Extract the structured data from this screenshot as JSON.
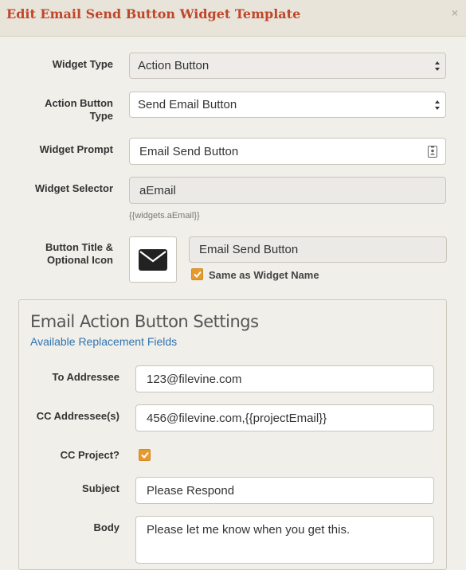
{
  "dialog": {
    "title": "Edit Email Send Button Widget Template",
    "close_label": "×"
  },
  "form": {
    "widget_type": {
      "label": "Widget Type",
      "value": "Action Button"
    },
    "action_button_type": {
      "label_line1": "Action Button",
      "label_line2": "Type",
      "value": "Send Email Button"
    },
    "widget_prompt": {
      "label": "Widget Prompt",
      "value": "Email Send Button"
    },
    "widget_selector": {
      "label": "Widget Selector",
      "value": "aEmail",
      "hint": "{{widgets.aEmail}}"
    },
    "button_title": {
      "label_line1": "Button Title &",
      "label_line2": "Optional Icon",
      "icon": "envelope-icon",
      "value": "Email Send Button",
      "same_as_name_label": "Same as Widget Name",
      "same_as_name_checked": true
    }
  },
  "email_settings": {
    "title": "Email Action Button Settings",
    "replacement_link": "Available Replacement Fields",
    "to": {
      "label": "To Addressee",
      "value": "123@filevine.com"
    },
    "cc": {
      "label": "CC Addressee(s)",
      "value": "456@filevine.com,{{projectEmail}}"
    },
    "cc_project": {
      "label": "CC Project?",
      "checked": true
    },
    "subject": {
      "label": "Subject",
      "value": "Please Respond"
    },
    "body": {
      "label": "Body",
      "value": "Please let me know when you get this."
    }
  },
  "colors": {
    "title_red": "#c0462a",
    "link_blue": "#2f73b3",
    "checkbox_orange": "#e69a2e"
  }
}
